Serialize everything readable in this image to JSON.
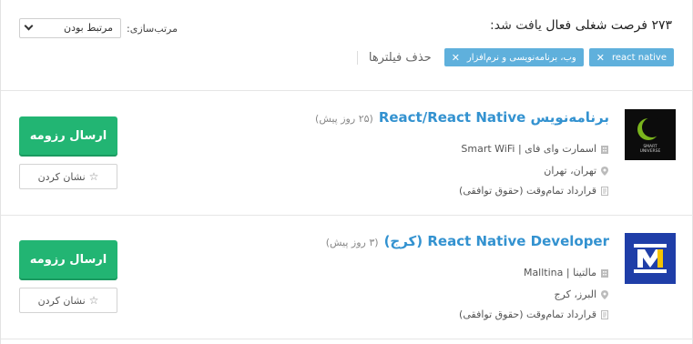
{
  "header": {
    "result_count": "۲۷۳",
    "result_text": "فرصت شغلی فعال",
    "result_suffix": "یافت شد:",
    "sort_label": "مرتب‌سازی:",
    "sort_selected": "مرتبط بودن"
  },
  "filters": {
    "chips": [
      {
        "label": "react native"
      },
      {
        "label": "وب، برنامه‌نویسی و نرم‌افزار"
      }
    ],
    "clear_label": "حذف فیلترها",
    "chip_color": "#5fb0dc"
  },
  "jobs": [
    {
      "title": "برنامه‌نویس React/React Native",
      "age": "(۲۵ روز پیش)",
      "company": "اسمارت وای فای | Smart WiFi",
      "location": "تهران، تهران",
      "contract": "قرارداد تمام‌وقت (حقوق توافقی)",
      "logo_text": "SMART UNIVERSE",
      "apply_label": "ارسال رزومه",
      "bookmark_label": "نشان کردن"
    },
    {
      "title": "React Native Developer (کرج)",
      "age": "(۳ روز پیش)",
      "company": "مالتینا | Malltina",
      "location": "البرز، کرج",
      "contract": "قرارداد تمام‌وقت (حقوق توافقی)",
      "logo_text": "M",
      "apply_label": "ارسال رزومه",
      "bookmark_label": "نشان کردن"
    }
  ],
  "colors": {
    "accent_blue": "#3392d0",
    "apply_green": "#22b573"
  }
}
